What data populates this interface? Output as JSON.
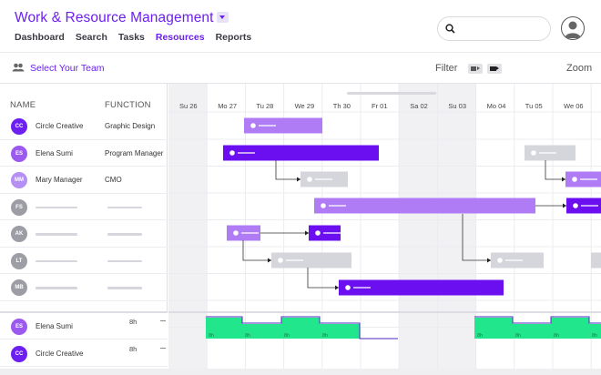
{
  "header": {
    "title": "Work & Resource Management",
    "nav": [
      "Dashboard",
      "Search",
      "Tasks",
      "Resources",
      "Reports"
    ],
    "active_nav": "Resources",
    "search_placeholder": ""
  },
  "toolbar": {
    "team_label": "Select Your Team",
    "filter_label": "Filter",
    "zoom_label": "Zoom"
  },
  "columns": {
    "name": "NAME",
    "function": "FUNCTION"
  },
  "members": [
    {
      "initials": "CC",
      "name": "Circle Creative",
      "function": "Graphic Design",
      "color": "#6b1ff0"
    },
    {
      "initials": "ES",
      "name": "Elena Sumi",
      "function": "Program Manager",
      "color": "#9b59f0"
    },
    {
      "initials": "MM",
      "name": "Mary Manager",
      "function": "CMO",
      "color": "#b68ff5"
    },
    {
      "initials": "FS",
      "name": "",
      "function": "",
      "color": "#9d9da6"
    },
    {
      "initials": "AK",
      "name": "",
      "function": "",
      "color": "#9d9da6"
    },
    {
      "initials": "LT",
      "name": "",
      "function": "",
      "color": "#9d9da6"
    },
    {
      "initials": "MB",
      "name": "",
      "function": "",
      "color": "#9d9da6"
    }
  ],
  "workload": [
    {
      "initials": "ES",
      "name": "Elena Sumi",
      "hours": "8h",
      "color": "#9b59f0"
    },
    {
      "initials": "CC",
      "name": "Circle Creative",
      "hours": "8h",
      "color": "#6b1ff0"
    }
  ],
  "timeline": {
    "days": [
      "Su 26",
      "Mo 27",
      "Tu 28",
      "We 29",
      "Th 30",
      "Fr 01",
      "Sa 02",
      "Su 03",
      "Mo 04",
      "Tu 05",
      "We 06"
    ],
    "weekend_indices": [
      0,
      6,
      7
    ],
    "bar_label": "8h",
    "colors": {
      "dark": "#6b0ff0",
      "light": "#b07cf5",
      "gray": "#d4d6dc",
      "workload": "#22e68c"
    }
  }
}
